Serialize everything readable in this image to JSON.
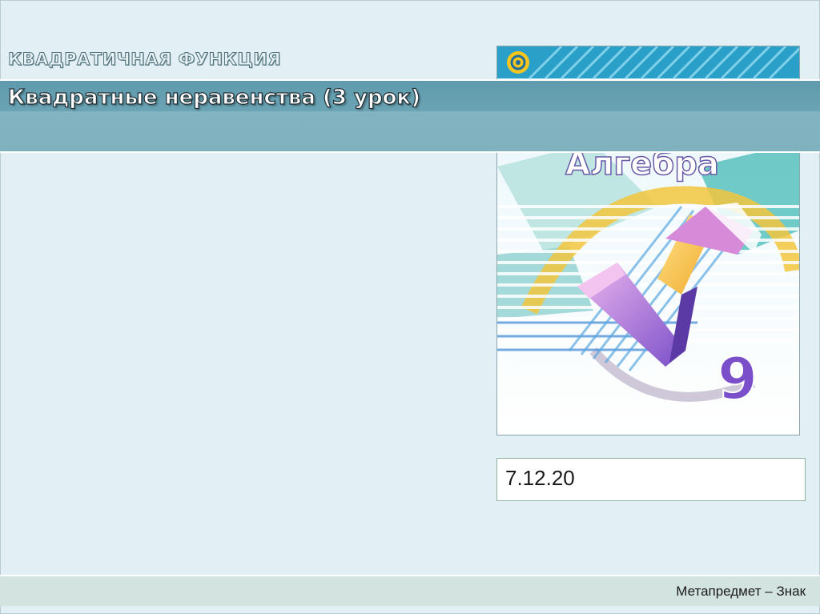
{
  "slide": {
    "section_title": "КВАДРАТИЧНАЯ ФУНКЦИЯ",
    "lesson_title": "Квадратные неравенства (3 урок)",
    "date": "7.12.20",
    "footer": "Метапредмет – Знак"
  },
  "book": {
    "title": "Алгебра",
    "grade": "9",
    "publisher_logo": "publisher-circle-logo",
    "colors": {
      "top_band": "#2a9fc8",
      "yellow": "#f2c53d",
      "purple": "#7a4fc9",
      "magenta": "#d78ad8",
      "teal": "#39b6b0",
      "blue_stripes": "#4a8fd8"
    }
  }
}
